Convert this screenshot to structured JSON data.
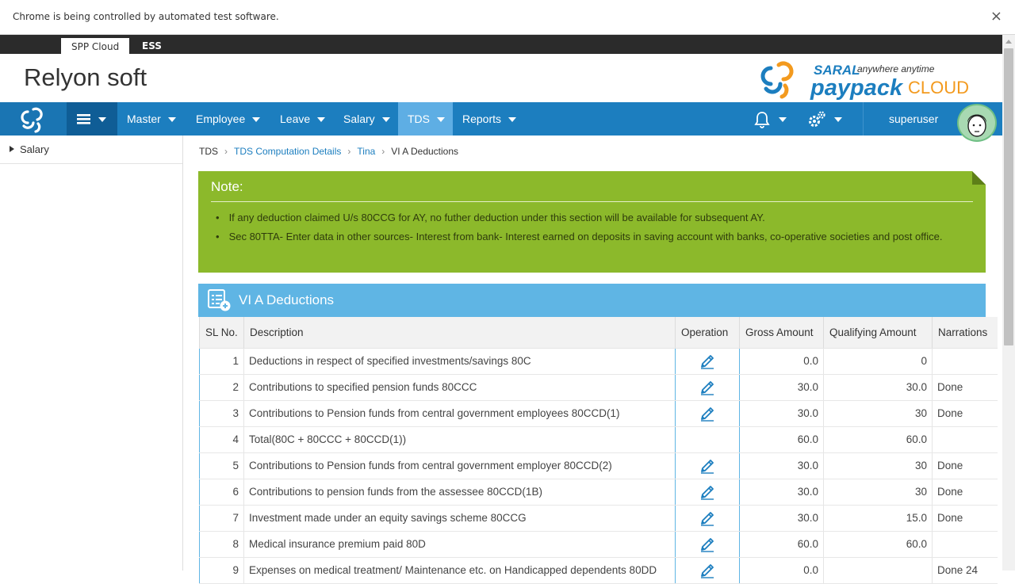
{
  "browser_infobar": {
    "message": "Chrome is being controlled by automated test software.",
    "close_glyph": "×"
  },
  "app_tabs": [
    "SPP Cloud",
    "ESS"
  ],
  "header": {
    "company": "Relyon soft",
    "brand_saral": "SARAL",
    "brand_tagline": "anywhere anytime",
    "brand_paypack": "paypack",
    "brand_cloud": "CLOUD"
  },
  "nav": {
    "items": [
      "Master",
      "Employee",
      "Leave",
      "Salary",
      "TDS",
      "Reports"
    ],
    "active": "TDS",
    "user": "superuser"
  },
  "sidebar": {
    "items": [
      "Salary"
    ]
  },
  "breadcrumb": [
    "TDS",
    "TDS Computation Details",
    "Tina",
    "VI A Deductions"
  ],
  "note": {
    "title": "Note:",
    "items": [
      "If any deduction claimed U/s 80CCG for AY, no futher deduction under this section will be available for subsequent AY.",
      "Sec 80TTA- Enter data in other sources- Interest from bank- Interest earned on deposits in saving account with banks, co-operative societies and post office."
    ]
  },
  "panel": {
    "title": "VI A Deductions",
    "columns": [
      "SL No.",
      "Description",
      "Operation",
      "Gross Amount",
      "Qualifying Amount",
      "Narrations"
    ],
    "rows": [
      {
        "sl": "1",
        "desc": "Deductions in respect of specified investments/savings 80C",
        "edit": true,
        "gross": "0.0",
        "qual": "0",
        "narr": ""
      },
      {
        "sl": "2",
        "desc": "Contributions to specified pension funds 80CCC",
        "edit": true,
        "gross": "30.0",
        "qual": "30.0",
        "narr": "Done"
      },
      {
        "sl": "3",
        "desc": "Contributions to Pension funds from central government employees 80CCD(1)",
        "edit": true,
        "gross": "30.0",
        "qual": "30",
        "narr": "Done"
      },
      {
        "sl": "4",
        "desc": "Total(80C + 80CCC + 80CCD(1))",
        "edit": false,
        "gross": "60.0",
        "qual": "60.0",
        "narr": ""
      },
      {
        "sl": "5",
        "desc": "Contributions to Pension funds from central government employer 80CCD(2)",
        "edit": true,
        "gross": "30.0",
        "qual": "30",
        "narr": "Done"
      },
      {
        "sl": "6",
        "desc": "Contributions to pension funds from the assessee 80CCD(1B)",
        "edit": true,
        "gross": "30.0",
        "qual": "30",
        "narr": "Done"
      },
      {
        "sl": "7",
        "desc": "Investment made under an equity savings scheme 80CCG",
        "edit": true,
        "gross": "30.0",
        "qual": "15.0",
        "narr": "Done"
      },
      {
        "sl": "8",
        "desc": "Medical insurance premium paid 80D",
        "edit": true,
        "gross": "60.0",
        "qual": "60.0",
        "narr": ""
      },
      {
        "sl": "9",
        "desc": "Expenses on medical treatment/ Maintenance etc. on Handicapped dependents 80DD",
        "edit": true,
        "gross": "0.0",
        "qual": "",
        "narr": "Done 24"
      }
    ]
  },
  "colors": {
    "navbar": "#1c7ebf",
    "nav_active": "#5eaee4",
    "note_bg": "#8cb92b",
    "panel_head": "#5fb5e4",
    "link": "#1c7ebf"
  },
  "icons": [
    "cloud-logo-icon",
    "menu-icon",
    "bell-icon",
    "gears-icon",
    "avatar",
    "list-add-icon",
    "pencil-icon"
  ]
}
